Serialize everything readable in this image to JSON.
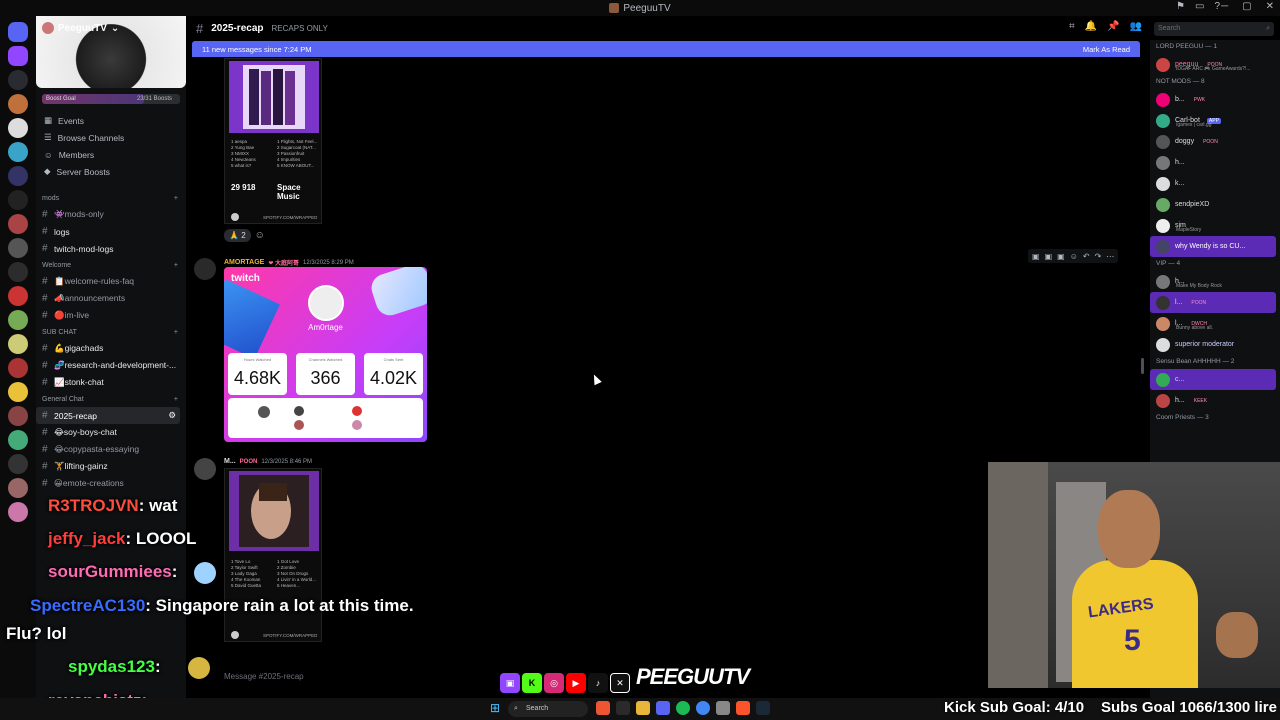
{
  "window": {
    "title": "PeeguuTV",
    "controls": [
      "─",
      "▢",
      "✕"
    ]
  },
  "server": {
    "name": "PeeguuTV",
    "boost_goal_label": "Boost Goal",
    "boost_count": "23/31 Boosts",
    "boost_fraction": 0.74
  },
  "side_links": [
    {
      "label": "Events",
      "icon": "calendar-icon"
    },
    {
      "label": "Browse Channels",
      "icon": "browse-icon"
    },
    {
      "label": "Members",
      "icon": "members-icon"
    },
    {
      "label": "Server Boosts",
      "icon": "boost-icon"
    }
  ],
  "categories": {
    "mods": "mods",
    "welcome": "Welcome",
    "sub_chat": "SUB CHAT",
    "general": "General Chat"
  },
  "channels": {
    "mods_only": "👾mods-only",
    "logs": "logs",
    "twitch_mod_logs": "twitch-mod-logs",
    "welcome_rules": "📋welcome-rules-faq",
    "announcements": "📣announcements",
    "im_live": "🔴im-live",
    "gigachads": "💪gigachads",
    "research": "🧬research-and-development-...",
    "stonk": "📈stonk-chat",
    "recap": "2025-recap",
    "soy_boys": "😂soy-boys-chat",
    "copypasta": "😂copypasta-essaying",
    "lifting": "🏋lifting-gainz",
    "emote": "😀emote-creations"
  },
  "chat_header": {
    "title": "2025-recap",
    "topic": "RECAPS ONLY"
  },
  "search": {
    "placeholder": "Search"
  },
  "new_messages": {
    "text": "11 new messages since 7:24 PM",
    "action": "Mark As Read"
  },
  "message_box": {
    "placeholder": "Message #2025-recap"
  },
  "messages": [
    {
      "card": {
        "top_artists": [
          "1 aespa",
          "2 Yung Bae",
          "3 NMIXX",
          "4 NewJeans",
          "5 what is?"
        ],
        "top_songs": [
          "1 Flights, Not Feel...",
          "2 Sugarcoat (NAT...",
          "3 Passionfruit",
          "4 Impurities",
          "5 KNOW ABOUT..."
        ],
        "minutes": "29 918",
        "genre": "Space Music",
        "url": "SPOTIFY.COM/WRAPPED"
      },
      "reaction_count": "2"
    },
    {
      "author": "AMORTAGE",
      "timestamp": "12/3/2025 8:29 PM",
      "twitch": {
        "logo": "twitch",
        "username": "Am0rtage",
        "stats": [
          {
            "label": "Hours Watched",
            "value": "4.68K"
          },
          {
            "label": "Channels Watched",
            "value": "366"
          },
          {
            "label": "Chats Sent",
            "value": "4.02K"
          }
        ]
      }
    },
    {
      "author": "M...",
      "author_tag": "POON",
      "timestamp": "12/3/2025 8:46 PM",
      "card": {
        "top_artists": [
          "1 Tove Lo",
          "2 Taylor Swift",
          "3 Lady Gaga",
          "4 The Kooman",
          "5 David Guetta"
        ],
        "top_songs": [
          "1 Got Love",
          "2 Zombie",
          "3 Not On Drugs",
          "4 Livin' in a World...",
          "5 Heaven..."
        ],
        "url": "SPOTIFY.COM/WRAPPED"
      }
    }
  ],
  "members": {
    "groups": [
      {
        "label": "LORD PEEGUU — 1",
        "rows": [
          {
            "name": "peeguu",
            "tag": "POON",
            "sub": "IDGAF ARC 🎮 GameAwards?!...",
            "color": "#ff6b9a",
            "av": "#c44"
          }
        ]
      },
      {
        "label": "NOT MODS — 8",
        "rows": [
          {
            "name": "b...",
            "tag": "PWK",
            "sub": "",
            "color": "#dbdee1",
            "av": "#e07"
          },
          {
            "name": "Carl-bot",
            "tag": "APP",
            "sub": "/games | carl.gg",
            "color": "#dbdee1",
            "av": "#3a8"
          },
          {
            "name": "doggy",
            "tag": "POON",
            "sub": "",
            "color": "#dbdee1",
            "av": "#555"
          },
          {
            "name": "h...",
            "tag": "",
            "sub": "",
            "color": "#dbdee1",
            "av": "#777"
          },
          {
            "name": "k...",
            "tag": "",
            "sub": "",
            "color": "#dbdee1",
            "av": "#ddd"
          },
          {
            "name": "sendpieXD",
            "tag": "",
            "sub": "",
            "color": "#dbdee1",
            "av": "#6a6"
          },
          {
            "name": "sim",
            "tag": "",
            "sub": "MapleStory",
            "color": "#dbdee1",
            "av": "#eee"
          },
          {
            "name": "why Wendy is so CU...",
            "tag": "",
            "sub": "",
            "color": "#ffffff",
            "av": "#446",
            "hl": true
          }
        ]
      },
      {
        "label": "VIP — 4",
        "rows": [
          {
            "name": "h...",
            "tag": "",
            "sub": "Make My Body Rock",
            "color": "#dbdee1",
            "av": "#777"
          },
          {
            "name": "l...",
            "tag": "POON",
            "sub": "",
            "color": "#dbdee1",
            "av": "#333",
            "hl": true
          },
          {
            "name": "l...",
            "tag": "DWCH",
            "sub": "Bunny above all.",
            "color": "#dbdee1",
            "av": "#c86"
          },
          {
            "name": "superior moderator",
            "tag": "",
            "sub": "",
            "color": "#c9cdfb",
            "av": "#ddd"
          }
        ]
      },
      {
        "label": "Sensu Bean AHHHHH — 2",
        "rows": [
          {
            "name": "c...",
            "tag": "",
            "sub": "",
            "color": "#dbdee1",
            "av": "#3a5",
            "hl": true
          },
          {
            "name": "h...",
            "tag": "KEEK",
            "sub": "",
            "color": "#dbdee1",
            "av": "#b44"
          }
        ]
      },
      {
        "label": "Coom Priests — 3",
        "rows": []
      }
    ]
  },
  "overlay_chat": [
    {
      "user": "R3TROJVN",
      "msg": ": wat",
      "color": "#ff4d3d"
    },
    {
      "user": "jeffy_jack",
      "msg": ": LOOOL",
      "color": "#ff3d3d"
    },
    {
      "user": "sourGummiees",
      "msg": ":",
      "color": "#ff6bb5"
    },
    {
      "user": "SpectreAC130",
      "msg": ": Singapore rain a lot at this time.",
      "color": "#3a6bff"
    },
    {
      "user": "",
      "msg": "Flu? lol",
      "color": "#ffffff"
    },
    {
      "user": "spydas123",
      "msg": ":",
      "color": "#44ff44"
    },
    {
      "user": "revanchistz",
      "msg": ":",
      "color": "#ff6bb5"
    }
  ],
  "brand": "PEEGUUTV",
  "goals": {
    "kick": "Kick Sub Goal: 4/10",
    "subs": "Subs Goal 1066/1300 lire"
  },
  "taskbar": {
    "search": "Search"
  },
  "colors": {
    "accent": "#5865f2",
    "twitch_pink": "#ff38a8",
    "sub_goal_text": "#ffffff"
  }
}
